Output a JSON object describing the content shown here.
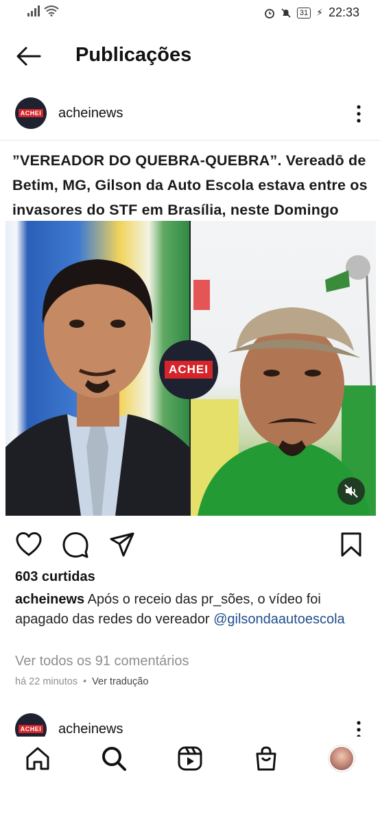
{
  "status_bar": {
    "time": "22:33",
    "battery": "31"
  },
  "header": {
    "title": "Publicações"
  },
  "post": {
    "username": "acheinews",
    "logo_text": "ACHEI",
    "headline": "”VEREADOR DO QUEBRA-QUEBRA”. Vereadō de Betim, MG, Gilson da Auto Escola estava entre os invasores do STF em Brasília, neste Domingo",
    "likes": "603 curtidas",
    "caption": {
      "user": "acheinews",
      "text": " Após o receio das pr_sões, o vídeo foi apagado das redes do vereador ",
      "mention": "@gilsondaautoescola"
    },
    "comments_link": "Ver todos os 91 comentários",
    "time_ago": "há 22 minutos",
    "separator": "•",
    "translate": "Ver tradução"
  },
  "next_post": {
    "username": "acheinews",
    "logo_text": "ACHEI"
  },
  "icons": {
    "back": "arrow-left-icon",
    "more": "more-vertical-icon",
    "like": "heart-icon",
    "comment": "comment-icon",
    "share": "send-icon",
    "save": "bookmark-icon",
    "mute": "speaker-muted-icon",
    "home": "home-icon",
    "search": "search-icon",
    "reels": "reels-icon",
    "shop": "shopping-bag-icon"
  },
  "colors": {
    "brand_red": "#d5242a",
    "logo_bg": "#1d2130",
    "mention": "#1f4d8c",
    "muted_text": "#8e8e8e"
  }
}
